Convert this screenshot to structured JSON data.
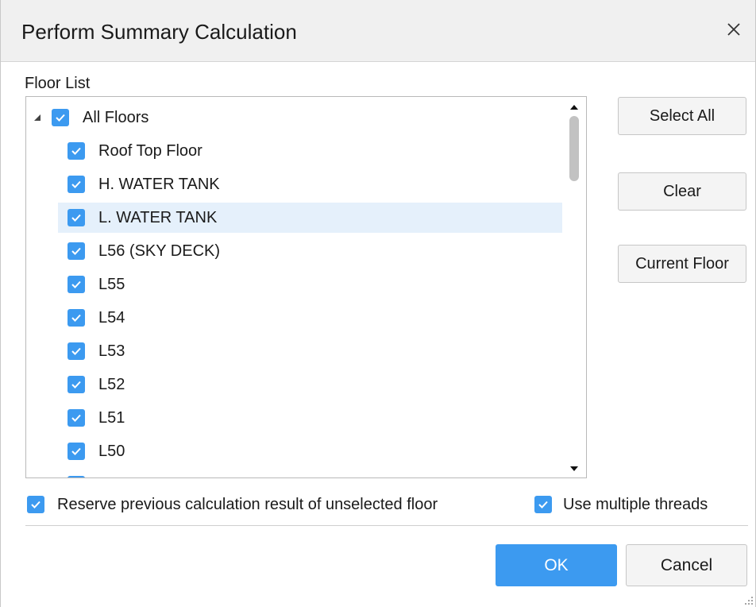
{
  "dialog": {
    "title": "Perform Summary Calculation",
    "close_icon": "close-icon"
  },
  "floor_list": {
    "label": "Floor List",
    "root": {
      "label": "All Floors",
      "checked": true,
      "expanded": true
    },
    "items": [
      {
        "label": "Roof Top Floor",
        "checked": true
      },
      {
        "label": "H. WATER TANK",
        "checked": true
      },
      {
        "label": "L. WATER TANK",
        "checked": true,
        "selected": true
      },
      {
        "label": "L56 (SKY DECK)",
        "checked": true
      },
      {
        "label": "L55",
        "checked": true
      },
      {
        "label": "L54",
        "checked": true
      },
      {
        "label": "L53",
        "checked": true
      },
      {
        "label": "L52",
        "checked": true
      },
      {
        "label": "L51",
        "checked": true
      },
      {
        "label": "L50",
        "checked": true
      },
      {
        "label": "",
        "checked": true
      }
    ]
  },
  "side_buttons": {
    "select_all": "Select All",
    "clear": "Clear",
    "current_floor": "Current Floor"
  },
  "options": {
    "reserve": {
      "label": "Reserve previous calculation result of unselected floor",
      "checked": true
    },
    "threads": {
      "label": "Use multiple threads",
      "checked": true
    }
  },
  "footer": {
    "ok": "OK",
    "cancel": "Cancel"
  },
  "colors": {
    "accent": "#3c9af0",
    "selected_row": "#e5f0fb"
  }
}
